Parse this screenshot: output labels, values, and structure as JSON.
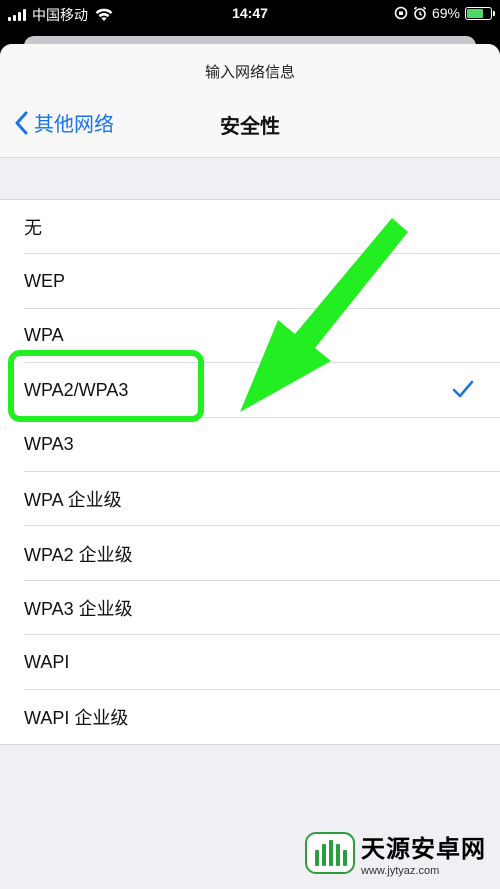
{
  "status_bar": {
    "carrier": "中国移动",
    "time": "14:47",
    "battery": "69%",
    "battery_level": 0.69
  },
  "sheet": {
    "title": "输入网络信息",
    "back_label": "其他网络",
    "nav_title": "安全性"
  },
  "options": [
    {
      "label": "无"
    },
    {
      "label": "WEP"
    },
    {
      "label": "WPA"
    },
    {
      "label": "WPA2/WPA3",
      "selected": true
    },
    {
      "label": "WPA3"
    },
    {
      "label": "WPA 企业级"
    },
    {
      "label": "WPA2 企业级"
    },
    {
      "label": "WPA3 企业级"
    },
    {
      "label": "WAPI"
    },
    {
      "label": "WAPI 企业级"
    }
  ],
  "colors": {
    "accent": "#1a73e8",
    "annotation": "#22ee22"
  },
  "watermark": {
    "name": "天源安卓网",
    "url": "www.jytyaz.com"
  }
}
